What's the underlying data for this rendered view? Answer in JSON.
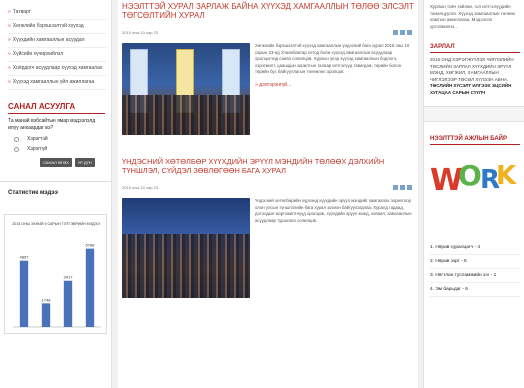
{
  "left": {
    "categories": [
      "Татварт",
      "Хөгжлийн бэрхшээлтэй хүүхэд",
      "Хүүхдийн хамгааллын асуудал",
      "Хүйсийн хүчирхийлэл",
      "Хоёрдогч асуудлаар хүүхэд хамгаалах",
      "Хүүхэд хамгааллын үйл ажиллагаа"
    ],
    "poll": {
      "title": "САНАЛ АСУУЛГА",
      "question": "Та манай вэбсайтын ямар мэдээлэлд илүү анхаардаг вэ?",
      "options": [
        "Хэрэгтэй",
        "Хэрэггүй"
      ],
      "vote_label": "САНАЛ ӨГӨХ",
      "result_label": "ҮР ДҮН"
    },
    "stats_title": "Статистик мэдээ"
  },
  "chart_data": {
    "type": "bar",
    "title": "2015 ОНЫ ЭХНИЙ 9 САРЫН ТЭТГЭВРИЙН МЭДЭЭ",
    "categories": [
      "",
      "",
      "",
      ""
    ],
    "values": [
      4897,
      1748,
      3417,
      5788
    ],
    "data_labels": [
      "4897",
      "1748",
      "3417",
      "5788"
    ],
    "ylim": [
      0,
      6500
    ],
    "colors": [
      "#4a72b8",
      "#4a72b8",
      "#4a72b8",
      "#4a72b8"
    ]
  },
  "articles": [
    {
      "title": "НЭЭЛТТЭЙ ХУРАЛ ЗАРЛАЖ БАЙНА ХҮҮХЭД ХАМГААЛЛЫН ТӨЛӨӨ ЭЛСЭЛТ ТӨГСӨЛТИЙН ХУРАЛ",
      "date": "2015 оны 10 сар 23",
      "text": "Хөгжлийн бэрхшээлтэй хүүхэд хамгааллын үндэсний бага хурал 2015 оны 10 сарын 23-нд Улаанбаатар хотод болж хүүхэд хамгааллын асуудлаар оролцогчид санал солилцов. Хурлын үеэр хүүхэд хамгааллын бодлого, хэрэгжилт, цаашдын зорилтын талаар илтгэлүүд тавигдаж, төрийн болон төрийн бус байгууллагын төлөөлөл оролцов.",
      "more": "» дэлгэрэнгүй..."
    },
    {
      "title": "ҮНДЭСНИЙ ХӨТӨЛБӨР ХҮҮХДИЙН ЭРҮҮЛ МЭНДИЙН ТӨЛӨӨХ ДЭЛХИЙН ТҮНШЛЭЛ, СҮЙДЭЛ ЗӨВЛӨГӨӨН БАГА ХУРАЛ",
      "date": "2015 оны 10 сар 23",
      "text": "Үндэсний хөтөлбөрийн хүрээнд хүүхдийн эрүүл мэндийг хамгаалах зорилгоор олон улсын түншлэлийн бага хурал зохион байгуулагдлаа. Хуралд гадаад, дотоодын мэргэжилтнүүд оролцож, хүүхдийн эрүүл мэнд, хөгжил, хамгааллын асуудлаар туршлага солилцов."
    }
  ],
  "right": {
    "top_text": "Хурлын товч тайлан, гол илтгэлүүдийн танилцуулга. Хүүхэд хамгааллын төлөөх хамтын ажиллагаа. Мэдээлэл үргэлжилнэ...",
    "section1_title": "ЗАРЛАЛ",
    "section1_text": "2015 ОНД ХЭРЭГЖҮҮЛЭХ ЧИГЛЭЛИЙН ТӨСЛИЙН ЗАРЛАЛ ХҮҮХДИЙН ЭРҮҮЛ МЭНД, ХӨГЖИЛ, ХАМГААЛЛЫН ЧИГЛЭЛЭЭР ТӨСӨЛ ХҮЛЭЭН АВНА.",
    "section1_bold": "ТӨСЛИЙН ХҮСЭЛТ ИЛГЭЭХ ЭЦСИЙН ХУГАЦАА САРЫН СҮҮЛЧ",
    "section2_title": "НЭЭЛТТЭЙ АЖЛЫН БАЙР",
    "work_word": "WORK",
    "rank": [
      "1. Нярав суралцагч - 4",
      "2. Нярав зэрг - 5",
      "3. Нягтлан тусламжийн зэг - 1",
      "4. Эм барьдаг - 6"
    ]
  }
}
